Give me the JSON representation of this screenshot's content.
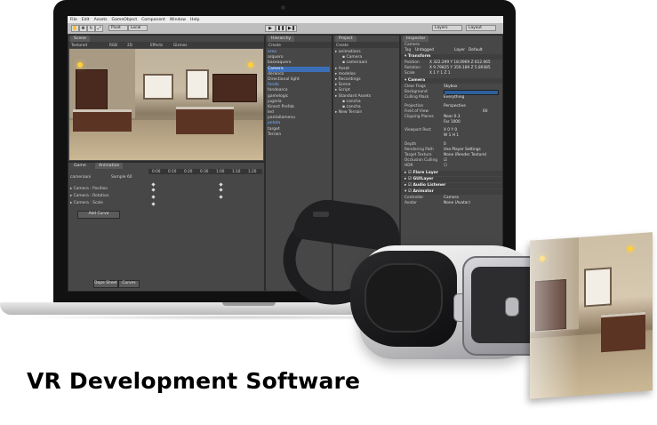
{
  "caption": "VR Development Software",
  "menu": [
    "File",
    "Edit",
    "Assets",
    "GameObject",
    "Component",
    "Window",
    "Help"
  ],
  "toolbar": {
    "pivot": "Pivot",
    "local": "Local",
    "play_icon": "play-icon",
    "pause_icon": "pause-icon",
    "step_icon": "step-icon",
    "layers": "Layers",
    "layout": "Layout"
  },
  "scene": {
    "tab": "Scene",
    "shading": "Textured",
    "mode": "RGB",
    "twod": "2D",
    "effects": "Effects",
    "gizmos": "Gizmos"
  },
  "hierarchy": {
    "tab": "Hierarchy",
    "create": "Create",
    "items": [
      "area",
      "arquero",
      "baseaquero",
      "Camera",
      "deranco",
      "Directional light",
      "fondo",
      "fondoarco",
      "gamelogic",
      "jugarla",
      "Kinect Prefab",
      "led",
      "pantallamenu",
      "pelota",
      "target",
      "Terrain"
    ],
    "selected_index": 3
  },
  "project": {
    "tab": "Project",
    "create": "Create",
    "items": [
      "animations",
      "Camera",
      "cameraani",
      "Asset",
      "modelos",
      "Recordings",
      "Scene",
      "Script",
      "Standard Assets",
      "cancha",
      "cancha",
      "New Terrain"
    ]
  },
  "inspector": {
    "tab": "Inspector",
    "object_name": "Camera",
    "tag_label": "Tag",
    "tag_value": "Untagged",
    "layer_label": "Layer",
    "layer_value": "Default",
    "transform_header": "Transform",
    "position_label": "Position",
    "position_values": "X 322.299  Y 18.0969  Z 612.065",
    "rotation_label": "Rotation",
    "rotation_values": "X 9.79825  Y 359.189  Z 5.89385",
    "scale_label": "Scale",
    "scale_values": "X 1  Y 1  Z 1",
    "camera_header": "Camera",
    "rows": [
      {
        "label": "Clear Flags",
        "value": "Skybox"
      },
      {
        "label": "Background",
        "value": ""
      },
      {
        "label": "Culling Mask",
        "value": "Everything"
      },
      {
        "label": "Projection",
        "value": "Perspective"
      },
      {
        "label": "Field of View",
        "value": "60"
      },
      {
        "label": "Clipping Planes",
        "value": "Near 0.3"
      },
      {
        "label": "",
        "value": "Far 1000"
      },
      {
        "label": "Viewport Rect",
        "value": "X 0   Y 0"
      },
      {
        "label": "",
        "value": "W 1   H 1"
      },
      {
        "label": "Depth",
        "value": "0"
      },
      {
        "label": "Rendering Path",
        "value": "Use Player Settings"
      },
      {
        "label": "Target Texture",
        "value": "None (Render Texture)"
      },
      {
        "label": "Occlusion Culling",
        "value": ""
      },
      {
        "label": "HDR",
        "value": ""
      }
    ],
    "components": [
      "Flare Layer",
      "GUILayer",
      "Audio Listener",
      "Animator"
    ],
    "controller_label": "Controller",
    "controller_value": "Camera",
    "avatar_label": "Avatar",
    "avatar_value": "None (Avatar)"
  },
  "game_tab": "Game",
  "animation": {
    "tab": "Animation",
    "clip": "cameraani",
    "samples_label": "Sample",
    "samples_value": "60",
    "ticks": [
      "0:00",
      "0:10",
      "0:20",
      "0:30",
      "1:00",
      "1:10",
      "1:20"
    ],
    "rows": [
      "Camera : Position",
      "Camera : Rotation",
      "Camera : Scale"
    ],
    "add_curve": "Add Curve",
    "dopesheet": "Dope Sheet",
    "curves": "Curves"
  },
  "colors": {
    "selection": "#3d6fb8",
    "caption": "#000000",
    "lamp": "#ffcf3a"
  }
}
